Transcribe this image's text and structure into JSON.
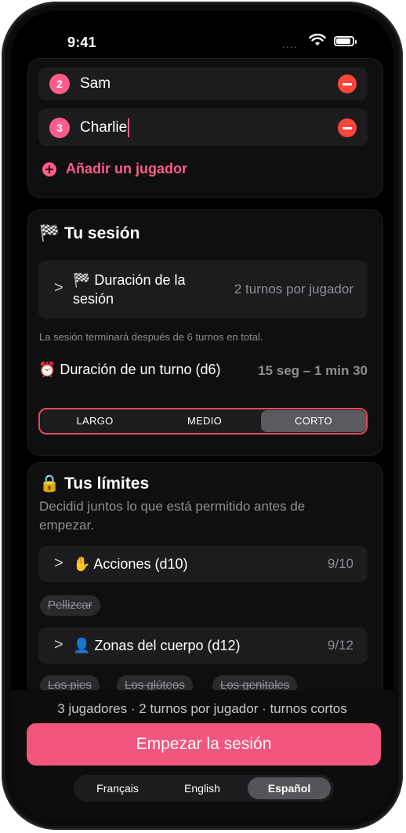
{
  "status_bar": {
    "time": "9:41",
    "signal": "....",
    "wifi_icon": "wifi-icon",
    "battery_icon": "battery-icon"
  },
  "players": {
    "items": [
      {
        "number": "2",
        "name": "Sam"
      },
      {
        "number": "3",
        "name": "Charlie"
      }
    ],
    "add_label": "Añadir un jugador"
  },
  "session": {
    "title": "🏁 Tu sesión",
    "duration_label": "🏁 Duración de la sesión",
    "duration_value": "2 turnos por jugador",
    "note": "La sesión terminará después de 6 turnos en total.",
    "turn_label": "⏰ Duración de un turno (d6)",
    "turn_value": "15 seg – 1 min 30",
    "options": [
      "LARGO",
      "MEDIO",
      "CORTO"
    ],
    "selected_option": "CORTO"
  },
  "limits": {
    "title": "🔒 Tus límites",
    "subtitle": "Decidid juntos lo que está permitido antes de empezar.",
    "actions_label": "✋ Acciones (d10)",
    "actions_count": "9/10",
    "actions_chips": [
      "Pellizcar"
    ],
    "zones_label": "👤 Zonas del cuerpo (d12)",
    "zones_count": "9/12",
    "zones_chips": [
      "Los pies",
      "Los glúteos",
      "Los genitales"
    ]
  },
  "footer": {
    "summary": "3 jugadores · 2 turnos por jugador · turnos cortos",
    "start_button": "Empezar la sesión",
    "languages": [
      "Français",
      "English",
      "Español"
    ],
    "selected_language": "Español"
  },
  "colors": {
    "accent": "#ff5c8a",
    "danger": "#ff453a",
    "background": "#000000",
    "card": "#1c1c1e"
  }
}
